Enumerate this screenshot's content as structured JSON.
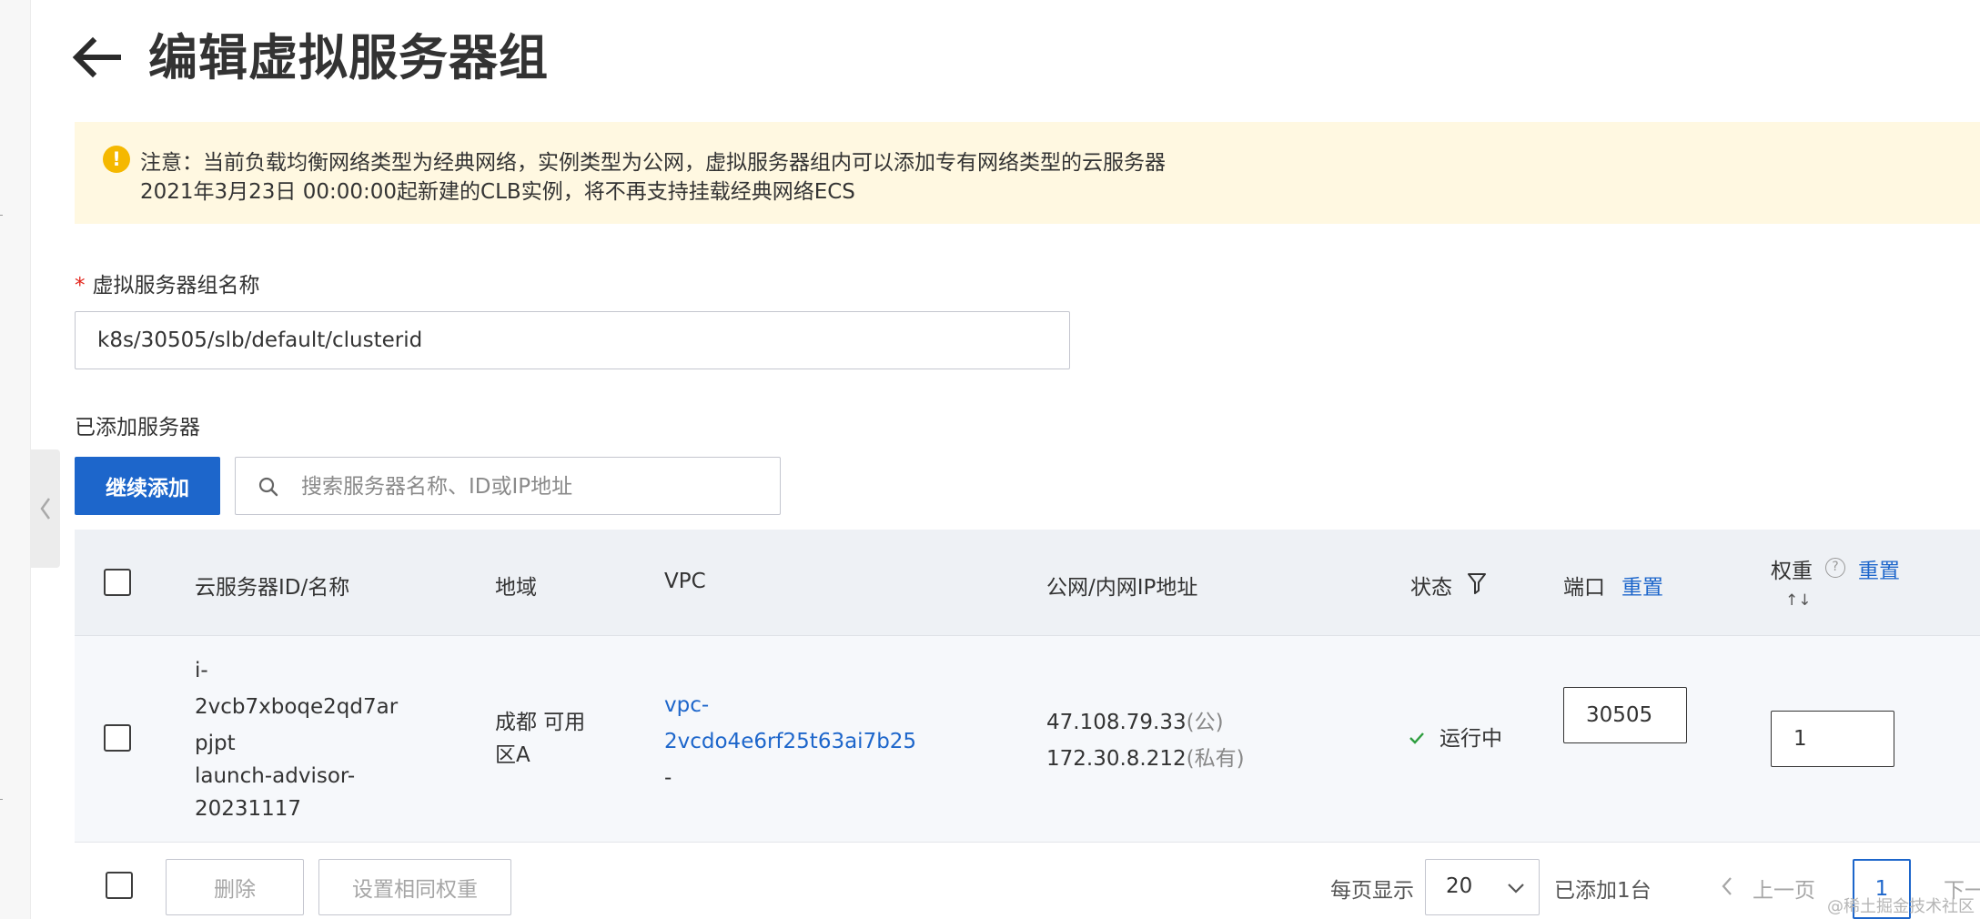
{
  "header": {
    "title": "编辑虚拟服务器组",
    "back_icon": "arrow-left-icon"
  },
  "notice": {
    "icon": "warning-icon",
    "icon_glyph": "!",
    "line1": "注意：当前负载均衡网络类型为经典网络，实例类型为公网，虚拟服务器组内可以添加专有网络类型的云服务器",
    "line2": "2021年3月23日 00:00:00起新建的CLB实例，将不再支持挂载经典网络ECS",
    "background": "#fff8e1",
    "icon_color": "#f5b800"
  },
  "form": {
    "required_mark": "*",
    "name_label": "虚拟服务器组名称",
    "name_value": "k8s/30505/slb/default/clusterid"
  },
  "servers": {
    "section_label": "已添加服务器",
    "add_button": "继续添加",
    "search_placeholder": "搜索服务器名称、ID或IP地址",
    "accent_color": "#1d66cb"
  },
  "table": {
    "columns": {
      "instance": "云服务器ID/名称",
      "region": "地域",
      "vpc": "VPC",
      "ip": "公网/内网IP地址",
      "status": "状态",
      "port": "端口",
      "port_reset": "重置",
      "weight": "权重",
      "weight_help": "?",
      "weight_reset": "重置",
      "weight_sort": "↑↓"
    },
    "rows": [
      {
        "id_lines": [
          "i-",
          "2vcb7xboqe2qd7ar",
          "pjpt"
        ],
        "name_lines": [
          "launch-advisor-",
          "20231117"
        ],
        "region_lines": [
          "成都 可用",
          "区A"
        ],
        "vpc_lines": [
          "vpc-",
          "2vcdo4e6rf25t63ai7b25"
        ],
        "vpc_suffix": "-",
        "public_ip": "47.108.79.33",
        "public_tag": "(公)",
        "private_ip": "172.30.8.212",
        "private_tag": "(私有)",
        "status_icon": "check-icon",
        "status": "运行中",
        "port": "30505",
        "weight": "1"
      }
    ]
  },
  "footer": {
    "delete_button": "删除",
    "same_weight_button": "设置相同权重",
    "per_page_label": "每页显示",
    "page_size": "20",
    "count_text": "已添加1台",
    "prev_label": "上一页",
    "current_page": "1",
    "next_label": "下一页"
  },
  "watermark": "@稀土掘金技术社区"
}
